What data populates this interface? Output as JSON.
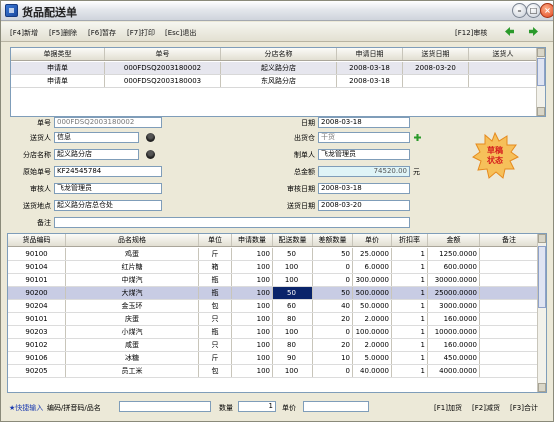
{
  "window": {
    "title": "货品配送单"
  },
  "toolbar": {
    "new": "[F4]新增",
    "delete": "[F5]删除",
    "hold": "[F6]暂存",
    "print": "[F7]打印",
    "exit": "[Esc]退出",
    "audit": "[F12]审核"
  },
  "top_grid": {
    "headers": [
      "单据类型",
      "单号",
      "分店名称",
      "申请日期",
      "送货日期",
      "送货人"
    ],
    "rows": [
      [
        "申请单",
        "000FDSQ2003180002",
        "起义路分店",
        "2008-03-18",
        "2008-03-20",
        ""
      ],
      [
        "申请单",
        "000FDSQ2003180003",
        "东风路分店",
        "2008-03-18",
        "",
        ""
      ]
    ]
  },
  "form": {
    "order_no_label": "单号",
    "order_no": "000FDSQ2003180002",
    "date_label": "日期",
    "date": "2008-03-18",
    "sender_label": "送货人",
    "sender": "信息",
    "warehouse_label": "出货仓",
    "warehouse": "干货",
    "branch_label": "分店名称",
    "branch": "起义路分店",
    "maker_label": "制单人",
    "maker": "飞龙管理员",
    "original_no_label": "原始单号",
    "original_no": "KF24545784",
    "amount_label": "总金额",
    "amount": "74520.00",
    "amount_unit": "元",
    "auditor_label": "审核人",
    "auditor": "飞龙管理员",
    "audit_date_label": "审核日期",
    "audit_date": "2008-03-18",
    "address_label": "送货地点",
    "address": "起义路分店总仓处",
    "delivery_date_label": "送货日期",
    "delivery_date": "2008-03-20",
    "remark_label": "备注",
    "remark": "",
    "stamp_line1": "草稿",
    "stamp_line2": "状态"
  },
  "main_grid": {
    "headers": [
      "货品编码",
      "品名规格",
      "单位",
      "申请数量",
      "配送数量",
      "差额数量",
      "单价",
      "折扣率",
      "金额",
      "备注"
    ],
    "rows": [
      [
        "90100",
        "鸡蛋",
        "斤",
        "100",
        "50",
        "50",
        "25.0000",
        "1",
        "1250.0000",
        ""
      ],
      [
        "90104",
        "红片糖",
        "箱",
        "100",
        "100",
        "0",
        "6.0000",
        "1",
        "600.0000",
        ""
      ],
      [
        "90101",
        "中煤汽",
        "瓶",
        "100",
        "100",
        "0",
        "300.0000",
        "1",
        "30000.0000",
        ""
      ],
      [
        "90200",
        "大煤汽",
        "瓶",
        "100",
        "50",
        "50",
        "500.0000",
        "1",
        "25000.0000",
        ""
      ],
      [
        "90204",
        "金玉环",
        "包",
        "100",
        "60",
        "40",
        "50.0000",
        "1",
        "3000.0000",
        ""
      ],
      [
        "90101",
        "庆蛋",
        "只",
        "100",
        "80",
        "20",
        "2.0000",
        "1",
        "160.0000",
        ""
      ],
      [
        "90203",
        "小煤汽",
        "瓶",
        "100",
        "100",
        "0",
        "100.0000",
        "1",
        "10000.0000",
        ""
      ],
      [
        "90102",
        "咸蛋",
        "只",
        "100",
        "80",
        "20",
        "2.0000",
        "1",
        "160.0000",
        ""
      ],
      [
        "90106",
        "冰糖",
        "斤",
        "100",
        "90",
        "10",
        "5.0000",
        "1",
        "450.0000",
        ""
      ],
      [
        "90205",
        "员工米",
        "包",
        "100",
        "100",
        "0",
        "40.0000",
        "1",
        "4000.0000",
        ""
      ]
    ]
  },
  "bottom": {
    "quick_label": "★快捷输入",
    "code_label": "编码/拼音码/品名",
    "code_value": "",
    "qty_label": "数量",
    "qty_value": "1",
    "price_label": "单价",
    "price_value": "",
    "add": "[F1]加货",
    "reduce": "[F2]减货",
    "total": "[F3]合计"
  }
}
